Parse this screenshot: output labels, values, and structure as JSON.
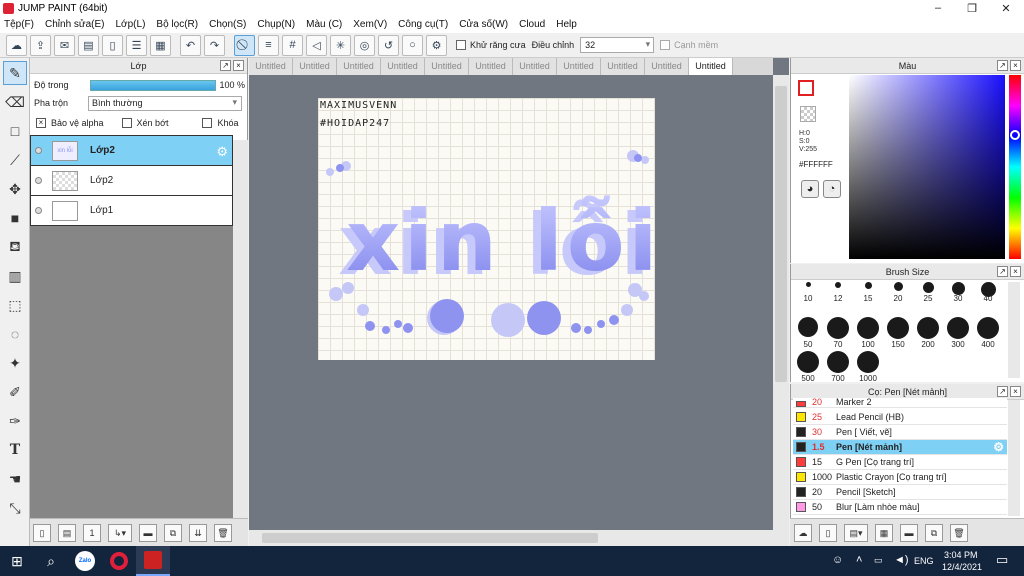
{
  "window": {
    "title": "JUMP PAINT (64bit)",
    "controls": [
      "–",
      "❐",
      "✕"
    ]
  },
  "menu": [
    "Tệp(F)",
    "Chỉnh sửa(E)",
    "Lớp(L)",
    "Bộ lọc(R)",
    "Chọn(S)",
    "Chụp(N)",
    "Màu (C)",
    "Xem(V)",
    "Công cụ(T)",
    "Cửa số(W)",
    "Cloud",
    "Help"
  ],
  "toolbar": {
    "antialias_label": "Khử răng cưa",
    "smooth_label": "Điều chỉnh",
    "smooth_value": "32",
    "snap_label": "Cạnh mềm"
  },
  "layer_panel": {
    "title": "Lớp",
    "opacity_label": "Độ trong",
    "opacity_value": "100 %",
    "blend_label": "Pha trộn",
    "blend_value": "Bình thường",
    "protect_alpha": "Bảo vệ alpha",
    "clipping": "Xén bớt",
    "lock": "Khóa",
    "layers": [
      {
        "name": "Lớp2",
        "selected": true,
        "thumb_text": "xin lỗi"
      },
      {
        "name": "Lớp2",
        "selected": false
      },
      {
        "name": "Lớp1",
        "selected": false
      }
    ]
  },
  "tabs": [
    "Untitled",
    "Untitled",
    "Untitled",
    "Untitled",
    "Untitled",
    "Untitled",
    "Untitled",
    "Untitled",
    "Untitled",
    "Untitled",
    "Untitled"
  ],
  "canvas": {
    "line1": "MAXIMUSVENN",
    "line2": "#HOIDAP247",
    "art_text": "xin lỗi",
    "art_color": "#8f93f0"
  },
  "color_panel": {
    "title": "Màu",
    "h": "H:0",
    "s": "S:0",
    "v": "V:255",
    "hex": "#FFFFFF"
  },
  "brush_panel": {
    "title": "Brush Size",
    "sizes": [
      "10",
      "12",
      "15",
      "20",
      "25",
      "30",
      "40",
      "50",
      "70",
      "100",
      "150",
      "200",
      "300",
      "400",
      "500",
      "700",
      "1000"
    ]
  },
  "pen_panel": {
    "title": "Cọ: Pen [Nét mảnh]",
    "items": [
      {
        "size": "20",
        "name": "Marker 2",
        "color": "#ff3b3b",
        "red": true
      },
      {
        "size": "25",
        "name": "Lead Pencil (HB)",
        "color": "#ffe600",
        "red": true
      },
      {
        "size": "30",
        "name": "Pen [ Viết, vẽ]",
        "color": "#222222",
        "red": true
      },
      {
        "size": "1.5",
        "name": "Pen [Nét mảnh]",
        "color": "#222222",
        "red": true,
        "selected": true
      },
      {
        "size": "15",
        "name": "G Pen [Cọ trang trí]",
        "color": "#ff3b3b",
        "red": false
      },
      {
        "size": "1000",
        "name": "Plastic Crayon [Cọ trang trí]",
        "color": "#ffe600",
        "red": false
      },
      {
        "size": "20",
        "name": "Pencil [Sketch]",
        "color": "#222222",
        "red": false
      },
      {
        "size": "50",
        "name": "Blur [Làm nhòe màu]",
        "color": "#ff9be6",
        "red": false
      }
    ]
  },
  "taskbar": {
    "time": "3:04 PM",
    "date": "12/4/2021",
    "lang": "ENG"
  }
}
